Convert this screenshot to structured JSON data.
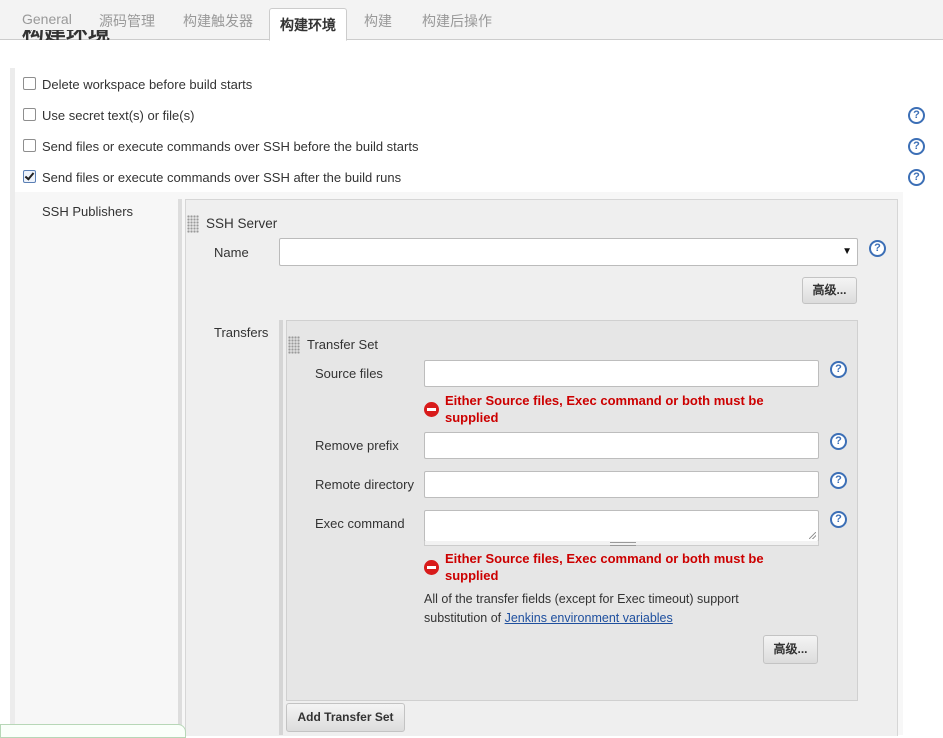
{
  "tabs": [
    {
      "label": "General"
    },
    {
      "label": "源码管理"
    },
    {
      "label": "构建触发器"
    },
    {
      "label": "构建环境"
    },
    {
      "label": "构建"
    },
    {
      "label": "构建后操作"
    }
  ],
  "section_title": "构建环境",
  "options": [
    {
      "label": "Delete workspace before build starts",
      "checked": false
    },
    {
      "label": "Use secret text(s) or file(s)",
      "checked": false
    },
    {
      "label": "Send files or execute commands over SSH before the build starts",
      "checked": false
    },
    {
      "label": "Send files or execute commands over SSH after the build runs",
      "checked": true
    }
  ],
  "help_glyph": "?",
  "ssh_publishers_label": "SSH Publishers",
  "ssh_server": {
    "title": "SSH Server",
    "name_label": "Name",
    "name_value": "",
    "advanced_button": "高级..."
  },
  "transfers": {
    "label": "Transfers",
    "set_title": "Transfer Set",
    "source_files_label": "Source files",
    "source_files_value": "",
    "remove_prefix_label": "Remove prefix",
    "remove_prefix_value": "",
    "remote_directory_label": "Remote directory",
    "remote_directory_value": "",
    "exec_command_label": "Exec command",
    "exec_command_value": "",
    "error_message": "Either Source files, Exec command or both must be supplied",
    "note_text": "All of the transfer fields (except for Exec timeout) support substitution of ",
    "note_link": "Jenkins environment variables",
    "advanced_button": "高级...",
    "add_button": "Add Transfer Set"
  },
  "colors": {
    "accent": "#3c6fb6",
    "error": "#cc0000",
    "link": "#1e4f9e"
  }
}
